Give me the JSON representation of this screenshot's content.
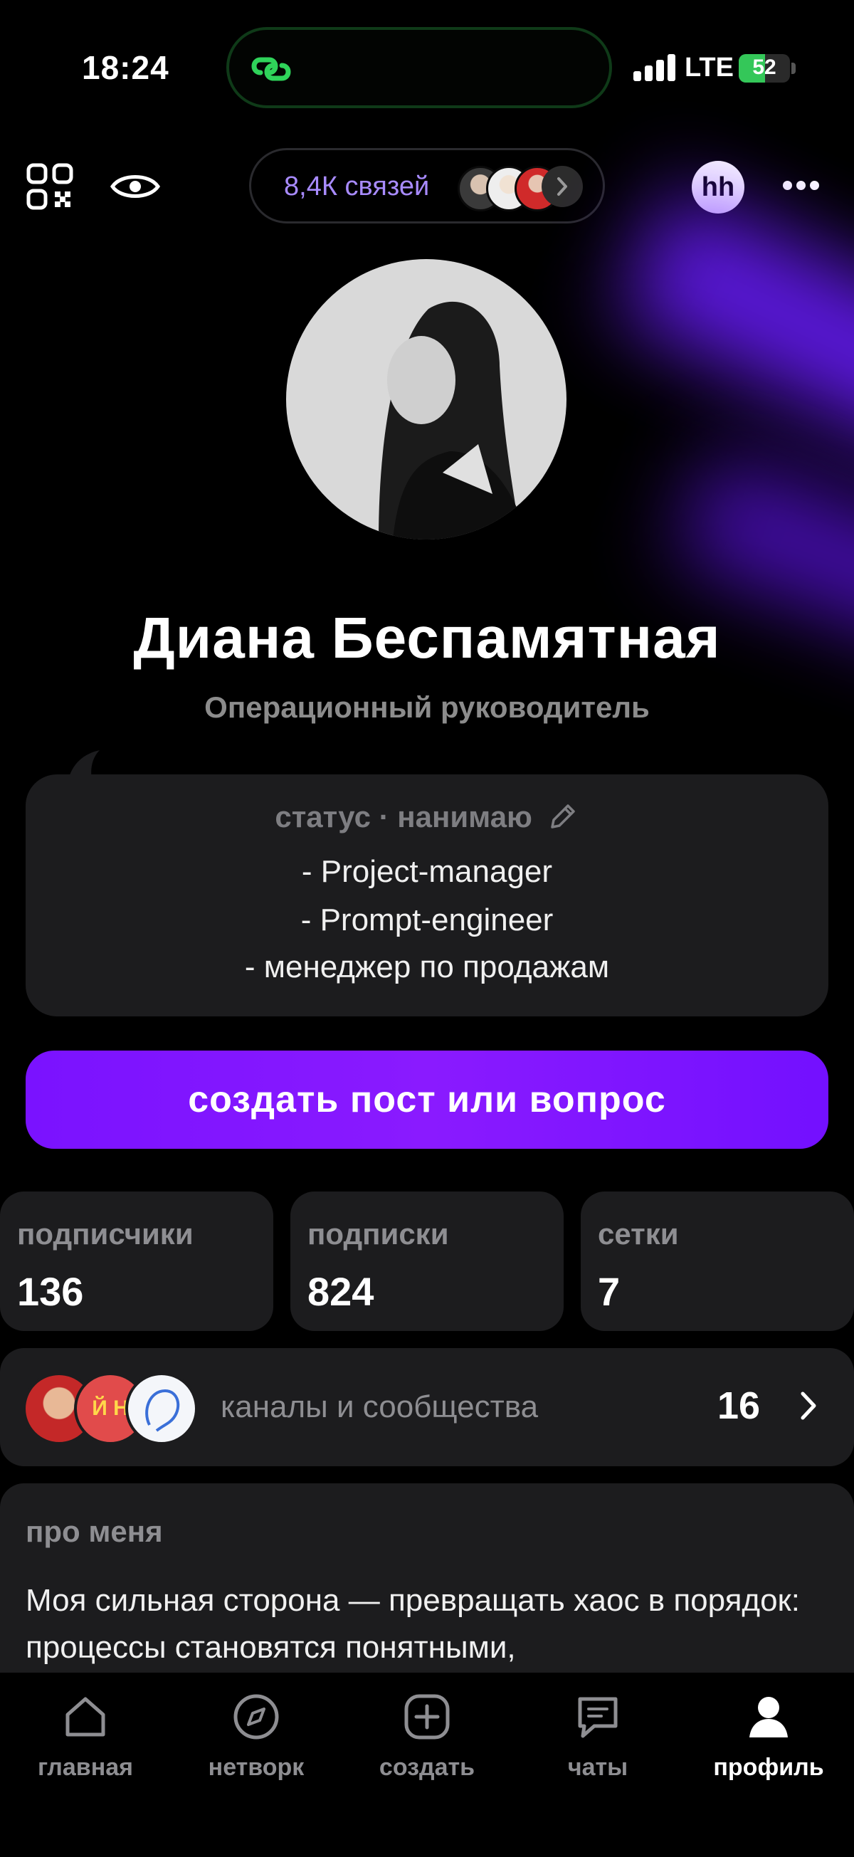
{
  "status_bar": {
    "time": "18:24",
    "network": "LTE",
    "battery": "52",
    "battery_level": 0.52
  },
  "top_bar": {
    "connections_label": "8,4К связей",
    "hh_label": "hh"
  },
  "profile": {
    "name": "Диана Беспамятная",
    "role": "Операционный руководитель"
  },
  "status_card": {
    "header": "статус · нанимаю",
    "lines": [
      "- Project-manager",
      "- Prompt-engineer",
      "- менеджер по продажам"
    ]
  },
  "cta_label": "создать пост или вопрос",
  "stats": [
    {
      "label": "подписчики",
      "value": "136"
    },
    {
      "label": "подписки",
      "value": "824"
    },
    {
      "label": "сетки",
      "value": "7"
    }
  ],
  "channels": {
    "label": "каналы и сообщества",
    "count": "16"
  },
  "about": {
    "header": "про меня",
    "text": "Моя сильная сторона — превращать хаос в порядок: процессы становятся понятными,"
  },
  "tabs": [
    {
      "label": "главная",
      "icon": "home-icon"
    },
    {
      "label": "нетворк",
      "icon": "compass-icon"
    },
    {
      "label": "создать",
      "icon": "plus-square-icon"
    },
    {
      "label": "чаты",
      "icon": "chat-icon"
    },
    {
      "label": "профиль",
      "icon": "profile-icon",
      "active": true
    }
  ],
  "colors": {
    "accent": "#7a12ff",
    "connections_text": "#a88bff",
    "card_bg": "#1c1c1e",
    "battery": "#34c759"
  }
}
